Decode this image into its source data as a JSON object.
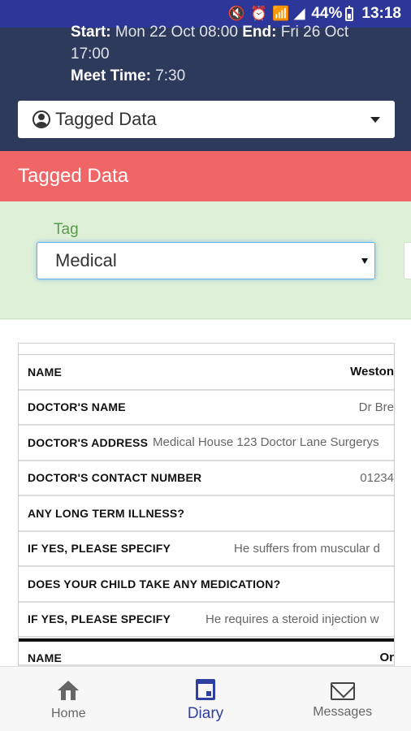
{
  "status_bar": {
    "battery_percent": "44%",
    "time": "13:18",
    "icons": [
      "mute-icon",
      "alarm-icon",
      "wifi-icon",
      "signal-icon",
      "battery-icon"
    ]
  },
  "event": {
    "start_label": "Start:",
    "start_value": "Mon 22 Oct 08:00",
    "end_label": "End:",
    "end_value": "Fri 26 Oct",
    "end_time": "17:00",
    "meet_label": "Meet Time:",
    "meet_value": "7:30"
  },
  "view_selector": {
    "selected": "Tagged Data",
    "icon": "user-icon"
  },
  "section": {
    "title": "Tagged Data"
  },
  "tag_filter": {
    "label": "Tag",
    "selected": "Medical"
  },
  "table": {
    "rows": [
      {
        "key": "NAME",
        "value": "Weston"
      },
      {
        "key": "DOCTOR'S NAME",
        "value": "Dr Bre"
      },
      {
        "key": "DOCTOR'S ADDRESS",
        "value": "Medical House 123 Doctor Lane Surgerys"
      },
      {
        "key": "DOCTOR'S CONTACT NUMBER",
        "value": "01234"
      },
      {
        "key": "ANY LONG TERM ILLNESS?",
        "value": ""
      },
      {
        "key": "IF YES, PLEASE SPECIFY",
        "value": "He suffers from muscular d"
      },
      {
        "key": "DOES YOUR CHILD TAKE ANY MEDICATION?",
        "value": ""
      },
      {
        "key": "IF YES, PLEASE SPECIFY",
        "value": "He requires a steroid injection w"
      }
    ],
    "next_row": {
      "key": "NAME",
      "value": "Or"
    }
  },
  "bottom_nav": {
    "items": [
      {
        "label": "Home",
        "icon": "home-icon",
        "active": false
      },
      {
        "label": "Diary",
        "icon": "calendar-icon",
        "active": true
      },
      {
        "label": "Messages",
        "icon": "mail-icon",
        "active": false
      }
    ]
  },
  "colors": {
    "status_bar": "#2c3799",
    "header": "#2e3a5c",
    "tagged_header": "#f06565",
    "tag_panel": "#dff0d8",
    "accent": "#2f3fa0"
  }
}
